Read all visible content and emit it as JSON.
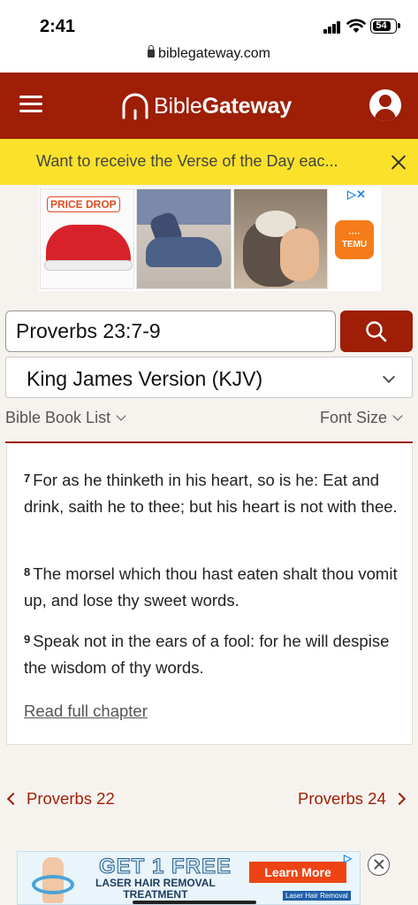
{
  "status_bar": {
    "time": "2:41",
    "battery": "54"
  },
  "browser": {
    "url": "biblegateway.com"
  },
  "header": {
    "logo_light": "Bible",
    "logo_bold": "Gateway"
  },
  "votd_banner": {
    "text": "Want to receive the Verse of the Day eac..."
  },
  "top_ad": {
    "badge": "PRICE DROP",
    "brand": "TEMU",
    "brand_small": "····"
  },
  "search": {
    "value": "Proverbs 23:7-9",
    "icon": "search-icon"
  },
  "version_select": {
    "selected": "King James Version (KJV)"
  },
  "toolbar": {
    "book_list": "Bible Book List",
    "font_size": "Font Size"
  },
  "passage": {
    "verses": [
      {
        "num": "7",
        "text": "For as he thinketh in his heart, so is he: Eat and drink, saith he to thee; but his heart is not with thee."
      },
      {
        "num": "8",
        "text": "The morsel which thou hast eaten shalt thou vomit up, and lose thy sweet words."
      },
      {
        "num": "9",
        "text": "Speak not in the ears of a fool: for he will despise the wisdom of thy words."
      }
    ],
    "read_full": "Read full chapter"
  },
  "chapter_nav": {
    "prev": "Proverbs 22",
    "next": "Proverbs 24"
  },
  "bottom_ad": {
    "title": "GET 1 FREE",
    "subtitle_1": "LASER HAIR REMOVAL",
    "subtitle_2": "TREATMENT",
    "cta": "Learn More",
    "small": "Laser Hair Removal"
  },
  "colors": {
    "brand": "#9e1e06",
    "banner": "#fbe12a",
    "cta": "#ee4415"
  }
}
